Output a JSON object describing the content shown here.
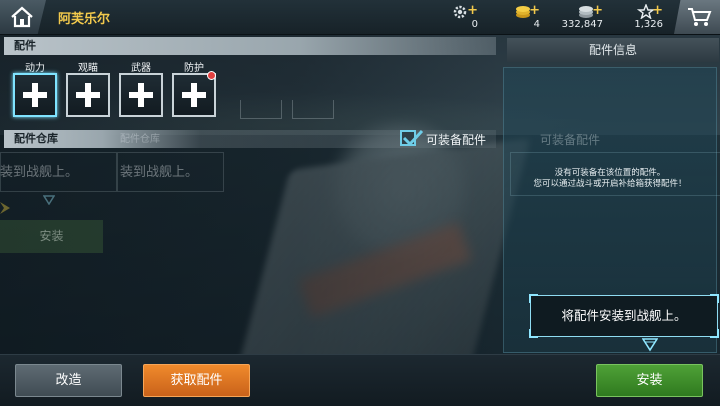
{
  "header": {
    "ship_name": "阿芙乐尔",
    "resources": [
      {
        "icon": "gear-icon",
        "value": "0"
      },
      {
        "icon": "gold-coins-icon",
        "value": "4"
      },
      {
        "icon": "silver-coins-icon",
        "value": "332,847"
      },
      {
        "icon": "star-icon",
        "value": "1,326"
      }
    ],
    "plus": "+"
  },
  "equipment": {
    "section_title": "配件",
    "slots": [
      {
        "label": "动力",
        "selected": true
      },
      {
        "label": "观瞄",
        "selected": false
      },
      {
        "label": "武器",
        "selected": false
      },
      {
        "label": "防护",
        "selected": false,
        "has_notification": true
      }
    ]
  },
  "storage": {
    "section_title": "配件仓库",
    "ghost_tab": "配件仓库",
    "filter_label": "可装备配件",
    "filter_checked": true,
    "ghost_texts": [
      "装到战舰上。",
      "装到战舰上。"
    ],
    "ghost_button": "安装"
  },
  "info": {
    "title": "配件信息",
    "ghost_text": "可装备配件",
    "message_line1": "没有可装备在该位置的配件。",
    "message_line2": "您可以通过战斗或开启补给箱获得配件！",
    "tooltip": "将配件安装到战舰上。"
  },
  "actions": {
    "upgrade": "改造",
    "get_parts": "获取配件",
    "install": "安装"
  },
  "colors": {
    "ship_name": "#f2c94c",
    "accent_cyan": "#7fe3ff",
    "orange_button": "#f08a2c",
    "green_button": "#4fa137",
    "gray_button": "#5e6b73"
  }
}
